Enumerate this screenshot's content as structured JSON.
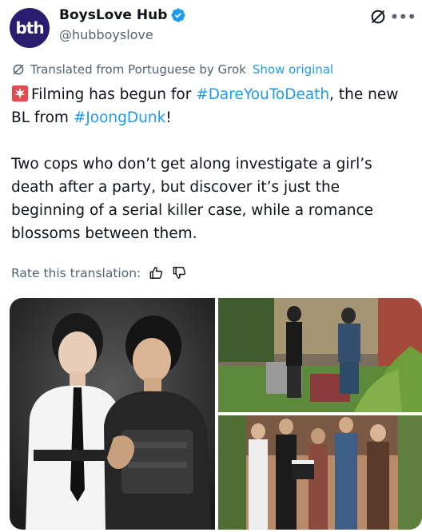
{
  "account": {
    "display_name": "BoysLove Hub",
    "handle": "@hubboyslove",
    "avatar_text": "bth",
    "verified": true
  },
  "translation": {
    "label": "Translated from Portuguese by Grok",
    "show_original": "Show original"
  },
  "tweet": {
    "line1_before": "Filming has begun for ",
    "hashtag1": "#DareYouToDeath",
    "line1_after": ", the new BL from ",
    "hashtag2": "#JoongDunk",
    "line1_end": "!",
    "paragraph2": "Two cops who don’t get along investigate a girl’s death after a party, but discover it’s just the beginning of a serial killer case, while a romance blossoms between them."
  },
  "rate": {
    "label": "Rate this translation:"
  },
  "icons": {
    "siren": "police-light-emoji",
    "grok": "grok-icon",
    "more": "more-icon",
    "thumbs_up": "thumbs-up-icon",
    "thumbs_down": "thumbs-down-icon"
  },
  "colors": {
    "accent": "#1d9bf0",
    "secondary_text": "#536471",
    "avatar_bg": "#2a1c6e"
  }
}
